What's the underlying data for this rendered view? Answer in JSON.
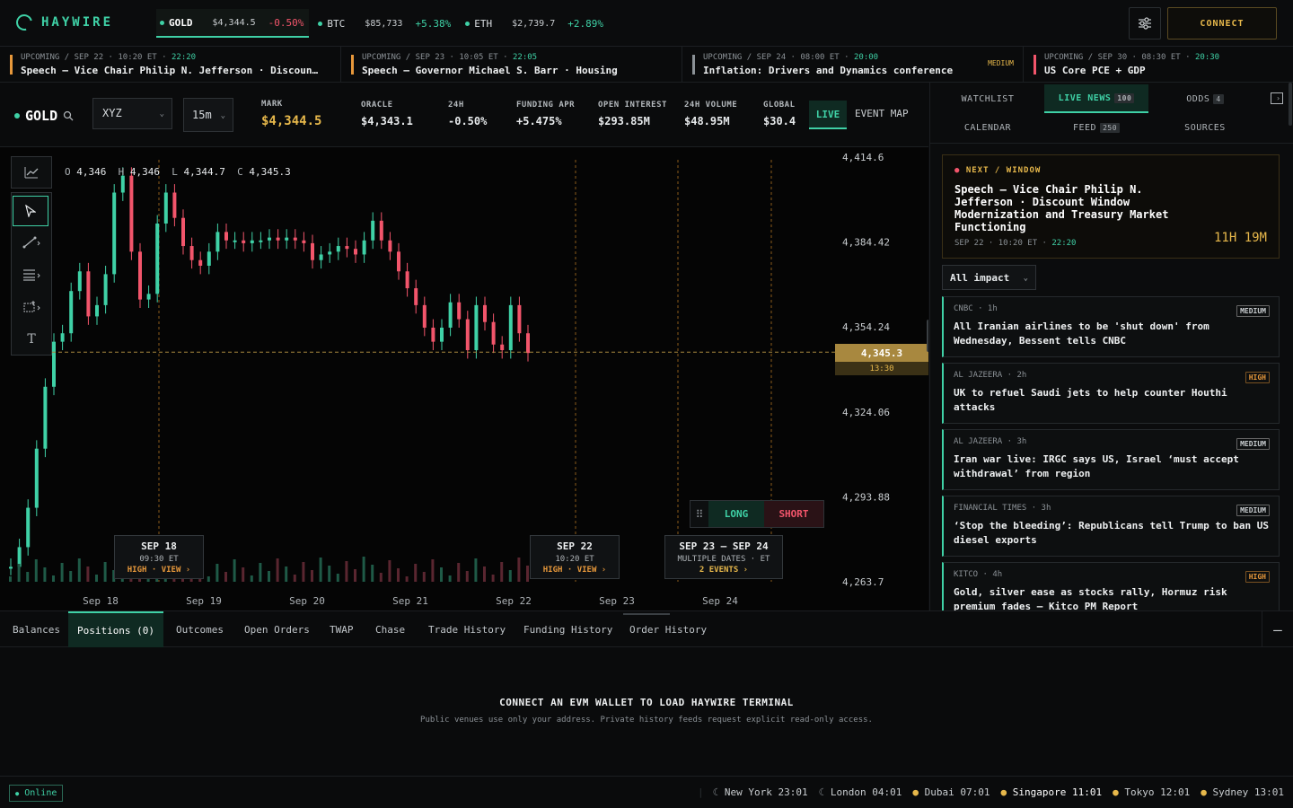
{
  "app": {
    "name": "HAYWIRE",
    "connect_label": "CONNECT"
  },
  "ticker": [
    {
      "symbol": "GOLD",
      "price": "$4,344.5",
      "change": "-0.50%",
      "dir": "neg",
      "active": true
    },
    {
      "symbol": "BTC",
      "price": "$85,733",
      "change": "+5.38%",
      "dir": "pos",
      "active": false
    },
    {
      "symbol": "ETH",
      "price": "$2,739.7",
      "change": "+2.89%",
      "dir": "pos",
      "active": false
    }
  ],
  "events": [
    {
      "meta": "UPCOMING / SEP 22 · 10:20 ET · ",
      "time": "22:20",
      "title": "Speech — Vice Chair Philip N. Jefferson · Discount Window Modernization",
      "impact": "",
      "color": "#e7983b"
    },
    {
      "meta": "UPCOMING / SEP 23 · 10:05 ET · ",
      "time": "22:05",
      "title": "Speech — Governor Michael S. Barr · Housing",
      "impact": "",
      "color": "#e7983b"
    },
    {
      "meta": "UPCOMING / SEP 24 · 08:00 ET · ",
      "time": "20:00",
      "title": "Inflation: Drivers and Dynamics conference",
      "impact": "MEDIUM",
      "color": "#8b9196"
    },
    {
      "meta": "UPCOMING / SEP 30 · 08:30 ET · ",
      "time": "20:30",
      "title": "US Core PCE + GDP",
      "impact": "",
      "color": "#f2556b"
    }
  ],
  "asset": {
    "name": "GOLD",
    "venue": "XYZ",
    "interval": "15m",
    "stats": [
      {
        "label": "MARK",
        "value": "$4,344.5",
        "color": "#e7b84b"
      },
      {
        "label": "ORACLE",
        "value": "$4,343.1",
        "color": "#e7eaec"
      },
      {
        "label": "24H",
        "value": "-0.50%",
        "color": "#f2556b"
      },
      {
        "label": "FUNDING APR",
        "value": "+5.475%",
        "color": "#3fd1a6"
      },
      {
        "label": "OPEN INTEREST",
        "value": "$293.85M",
        "color": "#e7eaec"
      },
      {
        "label": "24H VOLUME",
        "value": "$48.95M",
        "color": "#e7eaec"
      },
      {
        "label": "GLOBAL",
        "value": "$30.4",
        "color": "#e7eaec"
      }
    ],
    "live_label": "LIVE",
    "event_map_label": "EVENT MAP"
  },
  "chart_data": {
    "type": "candlestick",
    "ohlc_readout": {
      "o": "4,346",
      "h": "4,346",
      "l": "4,344.7",
      "c": "4,345.3"
    },
    "y_ticks": [
      "4,414.6",
      "4,384.42",
      "4,354.24",
      "4,324.06",
      "4,293.88",
      "4,263.7"
    ],
    "y_range": [
      4263.7,
      4414.6
    ],
    "x_ticks": [
      "Sep 18",
      "Sep 19",
      "Sep 20",
      "Sep 21",
      "Sep 22",
      "Sep 23",
      "Sep 24"
    ],
    "last_price": "4,345.3",
    "last_time": "13:30",
    "series": [
      {
        "name": "close",
        "values": [
          4269,
          4276,
          4290,
          4311,
          4333,
          4349,
          4352,
          4367,
          4374,
          4358,
          4362,
          4373,
          4402,
          4408,
          4381,
          4364,
          4366,
          4391,
          4402,
          4393,
          4383,
          4378,
          4376,
          4381,
          4388,
          4385,
          4385,
          4384,
          4385,
          4385,
          4386,
          4385,
          4386,
          4385,
          4384,
          4378,
          4380,
          4381,
          4383,
          4382,
          4380,
          4385,
          4392,
          4385,
          4381,
          4374,
          4368,
          4362,
          4354,
          4349,
          4354,
          4363,
          4357,
          4346,
          4362,
          4356,
          4348,
          4346,
          4362,
          4352,
          4345
        ]
      }
    ],
    "event_markers": [
      {
        "date": "SEP 18",
        "time": "09:30 ET",
        "action": "HIGH · VIEW ›"
      },
      {
        "date": "SEP 22",
        "time": "10:20 ET",
        "action": "HIGH · VIEW ›"
      },
      {
        "date": "SEP 23 — SEP 24",
        "time": "MULTIPLE DATES · ET",
        "action": "2 EVENTS ›"
      }
    ],
    "order_buttons": {
      "long": "LONG",
      "short": "SHORT"
    }
  },
  "panel": {
    "tabs": [
      {
        "label": "WATCHLIST",
        "badge": ""
      },
      {
        "label": "LIVE NEWS",
        "badge": "100"
      },
      {
        "label": "ODDS",
        "badge": "4"
      },
      {
        "label": "CALENDAR",
        "badge": ""
      },
      {
        "label": "FEED",
        "badge": "250"
      },
      {
        "label": "SOURCES",
        "badge": ""
      }
    ],
    "next": {
      "header": "NEXT / WINDOW",
      "title": "Speech — Vice Chair Philip N. Jefferson · Discount Window Modernization and Treasury Market Functioning",
      "meta": "SEP 22 · 10:20 ET · ",
      "time": "22:20",
      "countdown": "11H 19M"
    },
    "impact_filter": "All impact",
    "news": [
      {
        "source": "CNBC · 1h",
        "level": "MEDIUM",
        "title": "All Iranian airlines to be 'shut down' from Wednesday, Bessent tells CNBC"
      },
      {
        "source": "AL JAZEERA · 2h",
        "level": "HIGH",
        "title": "UK to refuel Saudi jets to help counter Houthi attacks"
      },
      {
        "source": "AL JAZEERA · 3h",
        "level": "MEDIUM",
        "title": "Iran war live: IRGC says US, Israel ‘must accept withdrawal’ from region"
      },
      {
        "source": "FINANCIAL TIMES · 3h",
        "level": "MEDIUM",
        "title": "‘Stop the bleeding’: Republicans tell Trump to ban US diesel exports"
      },
      {
        "source": "KITCO · 4h",
        "level": "HIGH",
        "title": "Gold, silver ease as stocks rally, Hormuz risk premium fades — Kitco PM Report"
      }
    ]
  },
  "bottom": {
    "tabs": [
      "Balances",
      "Positions (0)",
      "Outcomes",
      "Open Orders",
      "TWAP",
      "Chase",
      "Trade History",
      "Funding History",
      "Order History"
    ],
    "empty_title": "CONNECT AN EVM WALLET TO LOAD HAYWIRE TERMINAL",
    "empty_sub": "Public venues use only your address. Private history feeds request explicit read-only access."
  },
  "status": {
    "online": "Online",
    "clocks": [
      {
        "city": "New York",
        "time": "23:01"
      },
      {
        "city": "London",
        "time": "04:01"
      },
      {
        "city": "Dubai",
        "time": "07:01"
      },
      {
        "city": "Singapore",
        "time": "11:01"
      },
      {
        "city": "Tokyo",
        "time": "12:01"
      },
      {
        "city": "Sydney",
        "time": "13:01"
      }
    ]
  },
  "colors": {
    "accent": "#3fd1a6",
    "warn": "#e7b84b",
    "neg": "#f2556b"
  }
}
